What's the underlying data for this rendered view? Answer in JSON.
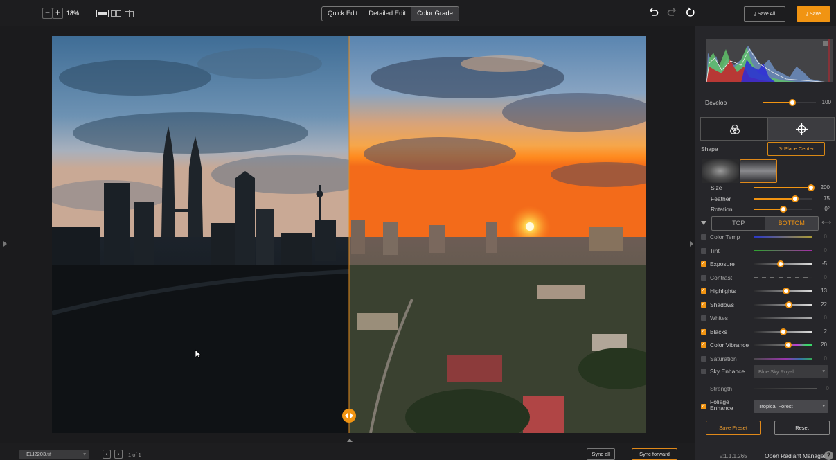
{
  "toolbar": {
    "zoom_out": "−",
    "zoom_in": "+",
    "zoom_level": "18%",
    "view_icons": [
      "single-view-icon",
      "side-by-side-view-icon",
      "split-view-icon"
    ],
    "modes": [
      "Quick Edit",
      "Detailed Edit",
      "Color Grade"
    ],
    "active_mode": "Color Grade",
    "undo_icon": "undo-icon",
    "redo_icon": "redo-icon",
    "reset_icon": "reset-icon",
    "save_all_label": "Save All",
    "save_label": "Save",
    "accent": "#f19412"
  },
  "bottombar": {
    "filename": "_ELI2203.tif",
    "page_count": "1 of 1",
    "sync_all": "Sync all",
    "sync_forward": "Sync forward"
  },
  "panel": {
    "develop": {
      "label": "Develop",
      "value": "100",
      "level": 0.55
    },
    "place_center": "Place Center",
    "shape_label": "Shape",
    "mask_sliders": [
      {
        "label": "Size",
        "value": "200",
        "level": 0.98
      },
      {
        "label": "Feather",
        "value": "75",
        "level": 0.71
      },
      {
        "label": "Rotation",
        "value": "0°",
        "level": 0.5
      }
    ],
    "top_label": "TOP",
    "bottom_label": "BOTTOM",
    "adjustments": [
      {
        "label": "Color Temp",
        "value": "0",
        "enabled": false,
        "level": null
      },
      {
        "label": "Tint",
        "value": "0",
        "enabled": false,
        "level": null
      },
      {
        "label": "Exposure",
        "value": "-5",
        "enabled": true,
        "level": 0.47
      },
      {
        "label": "Contrast",
        "value": "0",
        "enabled": false,
        "level": null
      },
      {
        "label": "Highlights",
        "value": "13",
        "enabled": true,
        "level": 0.56
      },
      {
        "label": "Shadows",
        "value": "22",
        "enabled": true,
        "level": 0.61
      },
      {
        "label": "Whites",
        "value": "0",
        "enabled": false,
        "level": null
      },
      {
        "label": "Blacks",
        "value": "2",
        "enabled": true,
        "level": 0.51
      },
      {
        "label": "Color Vibrance",
        "value": "20",
        "enabled": true,
        "level": 0.6
      },
      {
        "label": "Saturation",
        "value": "0",
        "enabled": false,
        "level": null
      }
    ],
    "sky_enhance": {
      "label": "Sky Enhance",
      "enabled": false,
      "option": "Blue Sky Royal"
    },
    "strength": {
      "label": "Strength",
      "value": "0"
    },
    "foliage": {
      "label": "Foliage Enhance",
      "label_line1": "Foliage",
      "label_line2": "Enhance",
      "enabled": true,
      "option": "Tropical Forest"
    },
    "save_preset": "Save Preset",
    "reset": "Reset",
    "version": "v:1.1.1.265",
    "open_radiant_manager": "Open Radiant Manager",
    "help": "?"
  }
}
